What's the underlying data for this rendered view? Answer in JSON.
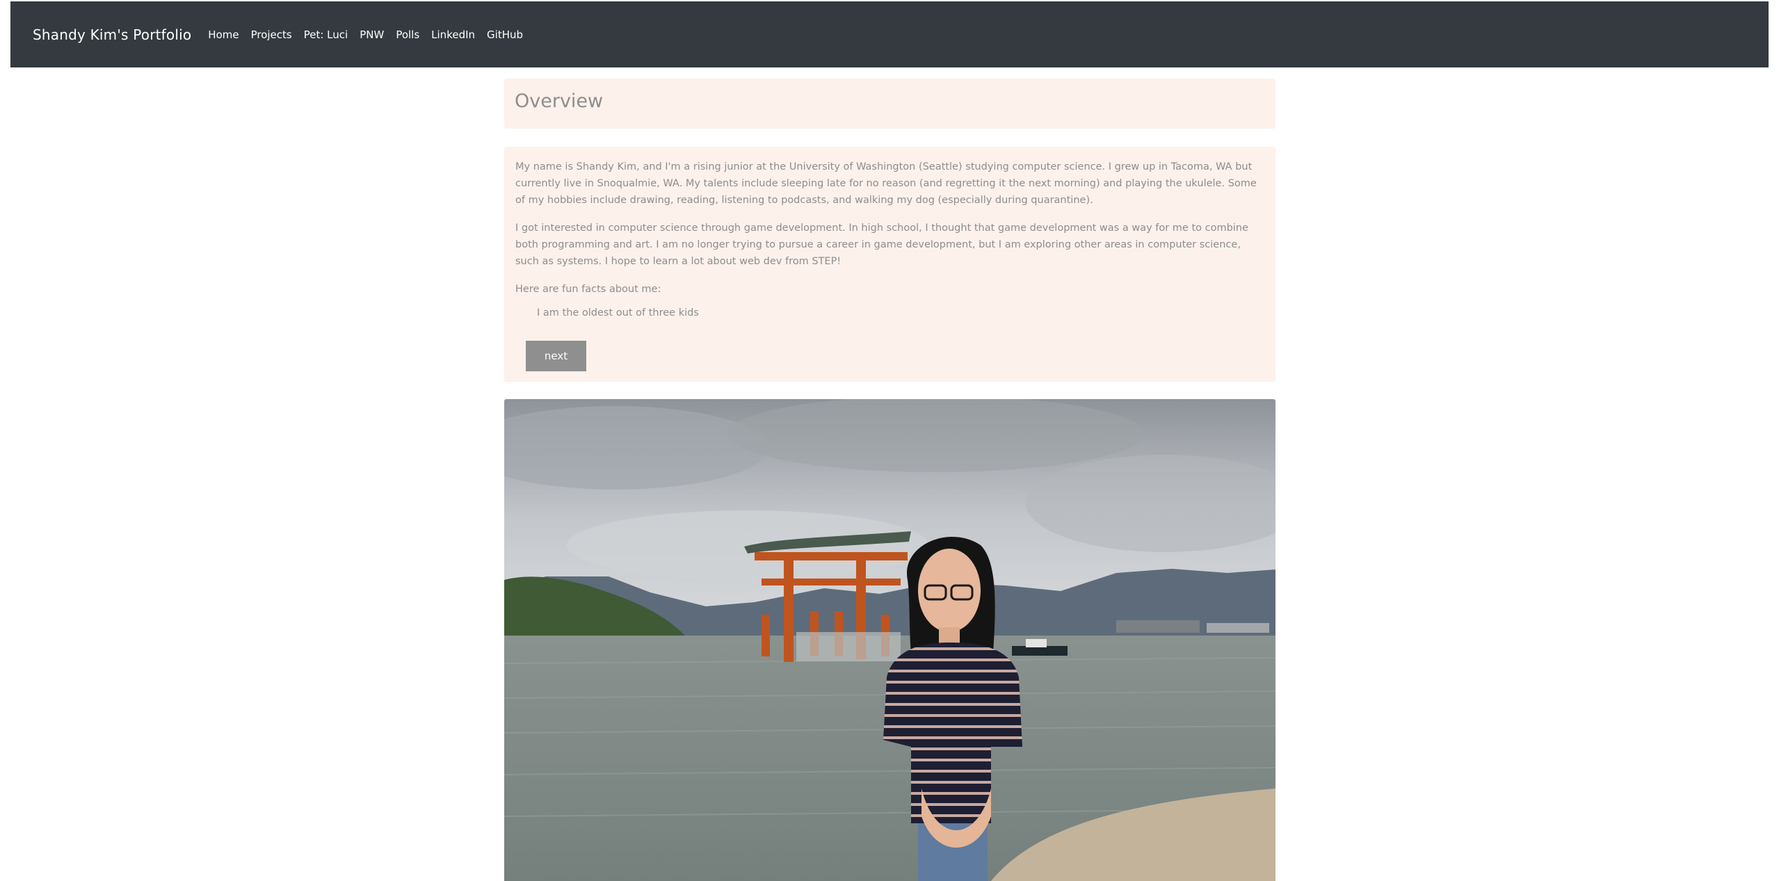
{
  "nav": {
    "brand": "Shandy Kim's Portfolio",
    "links": [
      "Home",
      "Projects",
      "Pet: Luci",
      "PNW",
      "Polls",
      "LinkedIn",
      "GitHub"
    ]
  },
  "overview": {
    "title": "Overview"
  },
  "about": {
    "paragraphs": [
      "My name is Shandy Kim, and I'm a rising junior at the University of Washington (Seattle) studying computer science. I grew up in Tacoma, WA but currently live in Snoqualmie, WA. My talents include sleeping late for no reason (and regretting it the next morning) and playing the ukulele. Some of my hobbies include drawing, reading, listening to podcasts, and walking my dog (especially during quarantine).",
      "I got interested in computer science through game development. In high school, I thought that game development was a way for me to combine both programming and art. I am no longer trying to pursue a career in game development, but I am exploring other areas in computer science, such as systems. I hope to learn a lot about web dev from STEP!",
      "Here are fun facts about me:"
    ],
    "fact": "I am the oldest out of three kids",
    "next_label": "next"
  },
  "colors": {
    "navbar": "#343a40",
    "card": "#fdf1ec",
    "text": "#8d8d8d",
    "button": "#8f8f8f"
  }
}
